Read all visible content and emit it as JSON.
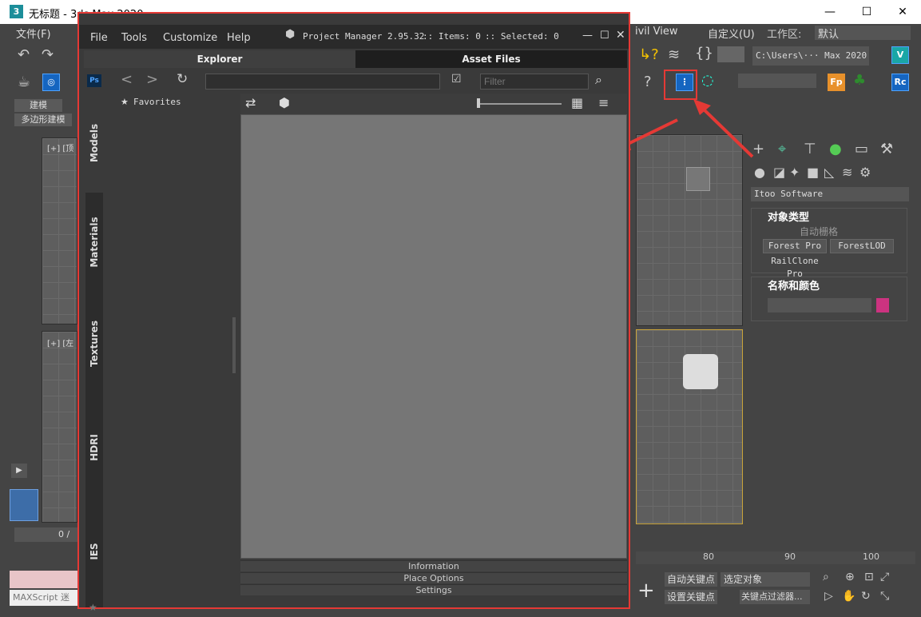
{
  "window": {
    "title": "无标题 - 3ds Max 2020",
    "app_icon": "3",
    "minimize": "—",
    "maximize": "☐",
    "close": "✕"
  },
  "menubar": {
    "file": "文件(F)",
    "civil_view": "ivil View",
    "custom": "自定义(U)",
    "workspace_label": "工作区:",
    "workspace_value": "默认"
  },
  "toolbar": {
    "path": "C:\\Users\\··· Max 2020",
    "fp": "Fp",
    "rc": "Rc"
  },
  "ribbon": {
    "tab": "建模",
    "subtab": "多边形建模"
  },
  "viewport": {
    "top_label": "[+] [顶",
    "left_label": "[+] [左"
  },
  "timeline": {
    "frame": "0 /",
    "ticks": [
      "80",
      "90",
      "100"
    ]
  },
  "script": {
    "placeholder": "MAXScript 迷"
  },
  "command_panel": {
    "category": "Itoo Software",
    "rollout1_title": "对象类型",
    "autogrid": "自动栅格",
    "buttons": [
      "Forest Pro",
      "ForestLOD",
      "RailClone Pro"
    ],
    "rollout2_title": "名称和颜色",
    "color": "#cc3380"
  },
  "status": {
    "auto_key": "自动关键点",
    "set_key": "设置关键点",
    "selected": "选定对象",
    "key_filter": "关键点过滤器..."
  },
  "pm": {
    "menus": [
      "File",
      "Tools",
      "Customize",
      "Help"
    ],
    "title": "Project Manager 2.95.32",
    "items": ":: Items: 0",
    "selected": ":: Selected: 0",
    "tabs": [
      "Explorer",
      "Asset Files"
    ],
    "filter_placeholder": "Filter",
    "ps": "Ps",
    "side_tabs": [
      "Models",
      "Materials",
      "Textures",
      "HDRI",
      "IES"
    ],
    "favorites": "Favorites",
    "accordion": [
      "Information",
      "Place Options",
      "Settings"
    ]
  },
  "colors": {
    "accent": "#e53935",
    "highlight": "#1565c0"
  }
}
